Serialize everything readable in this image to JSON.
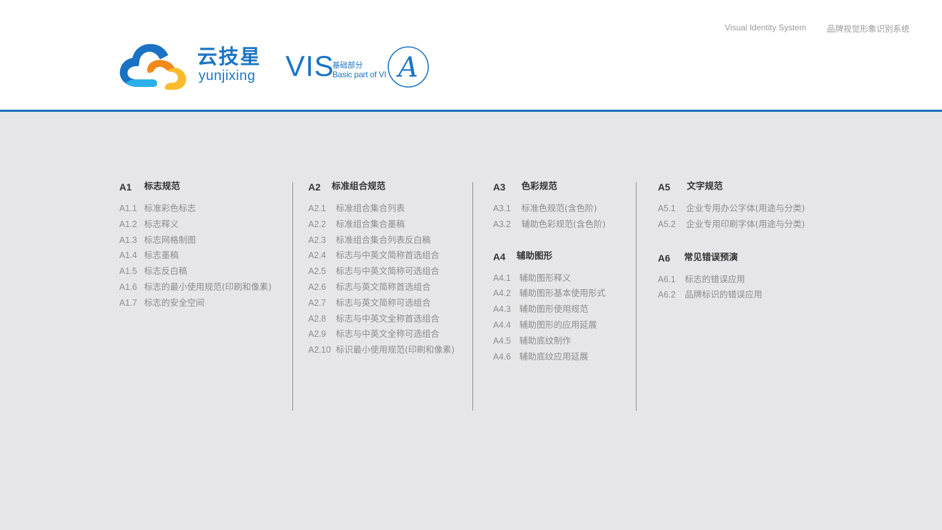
{
  "header": {
    "top_links": [
      "Visual Identity System",
      "品牌视觉形象识别系统"
    ],
    "brand": {
      "name_cn": "云技星",
      "name_en": "yunjixing"
    },
    "vis": {
      "title": "VIS",
      "subtitle_cn": "基础部分",
      "subtitle_en": "Basic part of VI",
      "emblem_letter": "A"
    },
    "colors": {
      "accent_blue": "#1b74c4",
      "rule_blue": "#1b6fbf",
      "logo_orange": "#f08a1c",
      "logo_yellow": "#fbbb2d",
      "logo_light_blue": "#2bb0ea"
    }
  },
  "sections": [
    {
      "id": "A1",
      "title": "标志规范",
      "items": [
        {
          "num": "A1.1",
          "label": "标准彩色标志"
        },
        {
          "num": "A1.2",
          "label": "标志释义"
        },
        {
          "num": "A1.3",
          "label": "标志网格制图"
        },
        {
          "num": "A1.4",
          "label": "标志墨稿"
        },
        {
          "num": "A1.5",
          "label": "标志反白稿"
        },
        {
          "num": "A1.6",
          "label": "标志的最小使用规范(印刷和像素)"
        },
        {
          "num": "A1.7",
          "label": "标志的安全空间"
        }
      ]
    },
    {
      "id": "A2",
      "title": "标准组合规范",
      "items": [
        {
          "num": "A2.1",
          "label": "标准组合集合列表"
        },
        {
          "num": "A2.2",
          "label": "标准组合集合墨稿"
        },
        {
          "num": "A2.3",
          "label": "标准组合集合列表反白稿"
        },
        {
          "num": "A2.4",
          "label": "标志与中英文简称首选组合"
        },
        {
          "num": "A2.5",
          "label": "标志与中英文简称可选组合"
        },
        {
          "num": "A2.6",
          "label": "标志与英文简称首选组合"
        },
        {
          "num": "A2.7",
          "label": "标志与英文简称可选组合"
        },
        {
          "num": "A2.8",
          "label": "标志与中英文全称首选组合"
        },
        {
          "num": "A2.9",
          "label": "标志与中英文全称可选组合"
        },
        {
          "num": "A2.10",
          "label": "标识最小使用规范(印刷和像素)"
        }
      ]
    },
    {
      "id": "A3",
      "title": "色彩规范",
      "items": [
        {
          "num": "A3.1",
          "label": "标准色规范(含色阶)"
        },
        {
          "num": "A3.2",
          "label": "辅助色彩规范(含色阶)"
        }
      ]
    },
    {
      "id": "A4",
      "title": "辅助图形",
      "items": [
        {
          "num": "A4.1",
          "label": "辅助图形释义"
        },
        {
          "num": "A4.2",
          "label": "辅助图形基本使用形式"
        },
        {
          "num": "A4.3",
          "label": "辅助图形使用规范"
        },
        {
          "num": "A4.4",
          "label": "辅助图形的应用延展"
        },
        {
          "num": "A4.5",
          "label": "辅助底纹制作"
        },
        {
          "num": "A4.6",
          "label": "辅助底纹应用延展"
        }
      ]
    },
    {
      "id": "A5",
      "title": "文字规范",
      "items": [
        {
          "num": "A5.1",
          "label": "企业专用办公字体(用途与分类)"
        },
        {
          "num": "A5.2",
          "label": "企业专用印刷字体(用途与分类)"
        }
      ]
    },
    {
      "id": "A6",
      "title": "常见错误预演",
      "items": [
        {
          "num": "A6.1",
          "label": "标志的错误应用"
        },
        {
          "num": "A6.2",
          "label": "品牌标识的错误应用"
        }
      ]
    }
  ]
}
